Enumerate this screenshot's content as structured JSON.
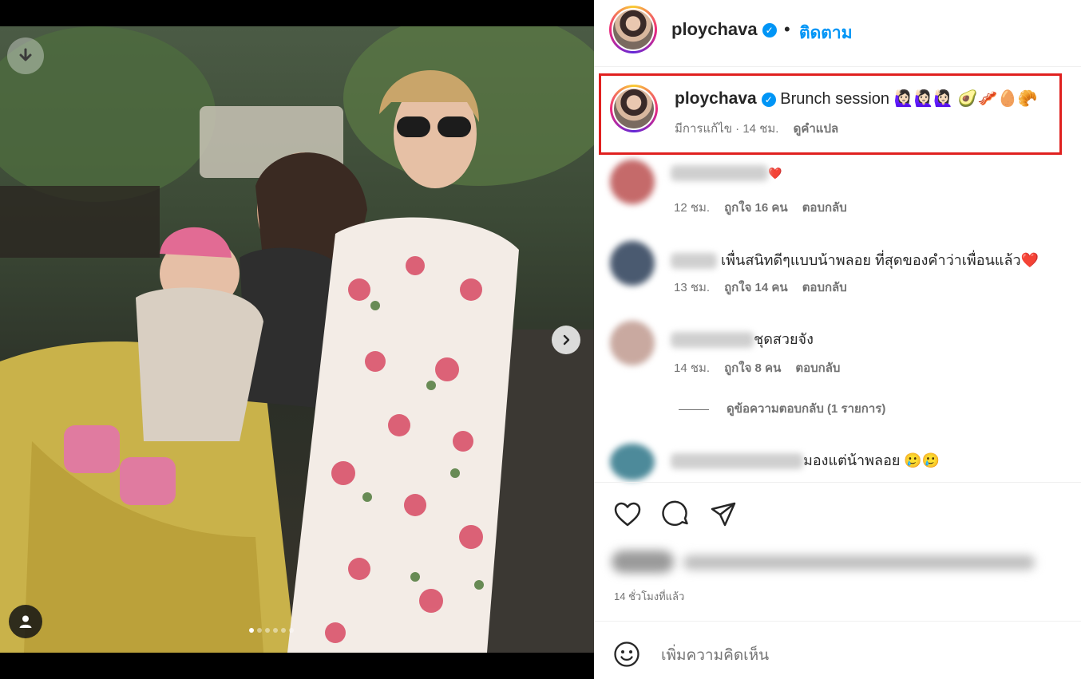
{
  "post": {
    "username": "ploychava",
    "verified": true,
    "separator": "•",
    "follow_label": "ติดตาม",
    "media_dots": 6,
    "media_active_dot": 0
  },
  "caption": {
    "username": "ploychava",
    "text": "Brunch session 🙋🏻‍♀️🙋🏻‍♀️🙋🏻‍♀️ 🥑🥓🥚🥐",
    "edited_label": "มีการแก้ไข",
    "time": "14 ชม.",
    "meta_sep": "·",
    "translate_label": "ดูคำแปล"
  },
  "comments": [
    {
      "text": "❤️",
      "time": "12 ชม.",
      "likes": "ถูกใจ 16 คน",
      "reply": "ตอบกลับ"
    },
    {
      "text": "เพื่นสนิทดีๆแบบน้าพลอย ที่สุดของคำว่าเพื่อนแล้ว❤️",
      "time": "13 ชม.",
      "likes": "ถูกใจ 14 คน",
      "reply": "ตอบกลับ"
    },
    {
      "text": "ชุดสวยจัง",
      "time": "14 ชม.",
      "likes": "ถูกใจ 8 คน",
      "reply": "ตอบกลับ"
    },
    {
      "text": "มองแต่น้าพลอย 🥲🥲"
    }
  ],
  "view_replies": "ดูข้อความตอบกลับ (1 รายการ)",
  "time_ago": "14 ชั่วโมงที่แล้ว",
  "add_comment": {
    "placeholder": "เพิ่มความคิดเห็น"
  },
  "icons": {
    "download": "download-icon",
    "next": "chevron-right-icon",
    "tagged_user": "user-icon",
    "like": "heart-icon",
    "comment": "comment-icon",
    "share": "share-icon",
    "emoji": "emoji-icon",
    "verified": "verified-badge-icon"
  },
  "colors": {
    "accent": "#0095f6",
    "highlight_border": "#e0201f",
    "muted_text": "#737373",
    "heart": "#ed4956"
  }
}
